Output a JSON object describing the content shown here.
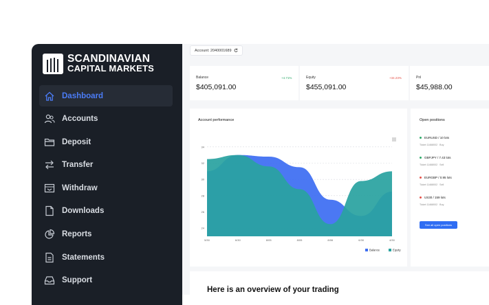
{
  "brand": {
    "line1": "SCANDINAVIAN",
    "line2": "CAPITAL MARKETS"
  },
  "sidebar": {
    "items": [
      {
        "label": "Dashboard",
        "icon": "home-icon",
        "active": true
      },
      {
        "label": "Accounts",
        "icon": "users-icon"
      },
      {
        "label": "Deposit",
        "icon": "folder-icon"
      },
      {
        "label": "Transfer",
        "icon": "transfer-icon"
      },
      {
        "label": "Withdraw",
        "icon": "withdraw-icon"
      },
      {
        "label": "Downloads",
        "icon": "document-icon"
      },
      {
        "label": "Reports",
        "icon": "pie-chart-icon"
      },
      {
        "label": "Statements",
        "icon": "statement-icon"
      },
      {
        "label": "Support",
        "icon": "inbox-icon"
      }
    ]
  },
  "account": {
    "label": "Account: 2040001689"
  },
  "stats": [
    {
      "label": "Balance",
      "delta": "+4.71%",
      "value": "$405,091.00",
      "delta_color": "#2eaa6a"
    },
    {
      "label": "Equity",
      "delta": "+34.23%",
      "value": "$455,091.00",
      "delta_color": "#e5524a"
    },
    {
      "label": "Pnl",
      "delta": "",
      "value": "$45,988.00",
      "delta_color": "#2eaa6a"
    }
  ],
  "chart_panel": {
    "title": "Account performance"
  },
  "chart_data": {
    "type": "area",
    "x": [
      "5/30",
      "6/30",
      "8/05",
      "8/05",
      "8/06",
      "6/30",
      "4/30"
    ],
    "yticks": [
      24,
      26,
      28,
      30,
      32,
      34
    ],
    "series": [
      {
        "name": "Balance",
        "color": "#3d6ef2",
        "values": [
          31.0,
          33.0,
          32.8,
          31.5,
          27.5,
          25.5,
          28.5
        ]
      },
      {
        "name": "Equity",
        "color": "#2aa3a0",
        "values": [
          32.5,
          33.0,
          31.6,
          28.8,
          24.5,
          29.8,
          31.0
        ]
      }
    ]
  },
  "positions_panel": {
    "title": "Open positions",
    "items": [
      {
        "pair": "EURUSD",
        "lots": "10 lots",
        "ticket": "Ticket 11468002",
        "side": "Buy",
        "dot": "#2eaa6a"
      },
      {
        "pair": "GBPJPY",
        "lots": "7.43 lots",
        "ticket": "Ticket 11468002",
        "side": "Sell",
        "dot": "#2eaa6a"
      },
      {
        "pair": "EURGBP",
        "lots": "0.95 lots",
        "ticket": "Ticket 11468002",
        "side": "Sell",
        "dot": "#e5524a"
      },
      {
        "pair": "US30",
        "lots": "159 lots",
        "ticket": "Ticket 11468002",
        "side": "Buy",
        "dot": "#e5524a"
      }
    ],
    "button": "See all open positions"
  },
  "overview": {
    "heading": "Here is an overview of your trading"
  }
}
